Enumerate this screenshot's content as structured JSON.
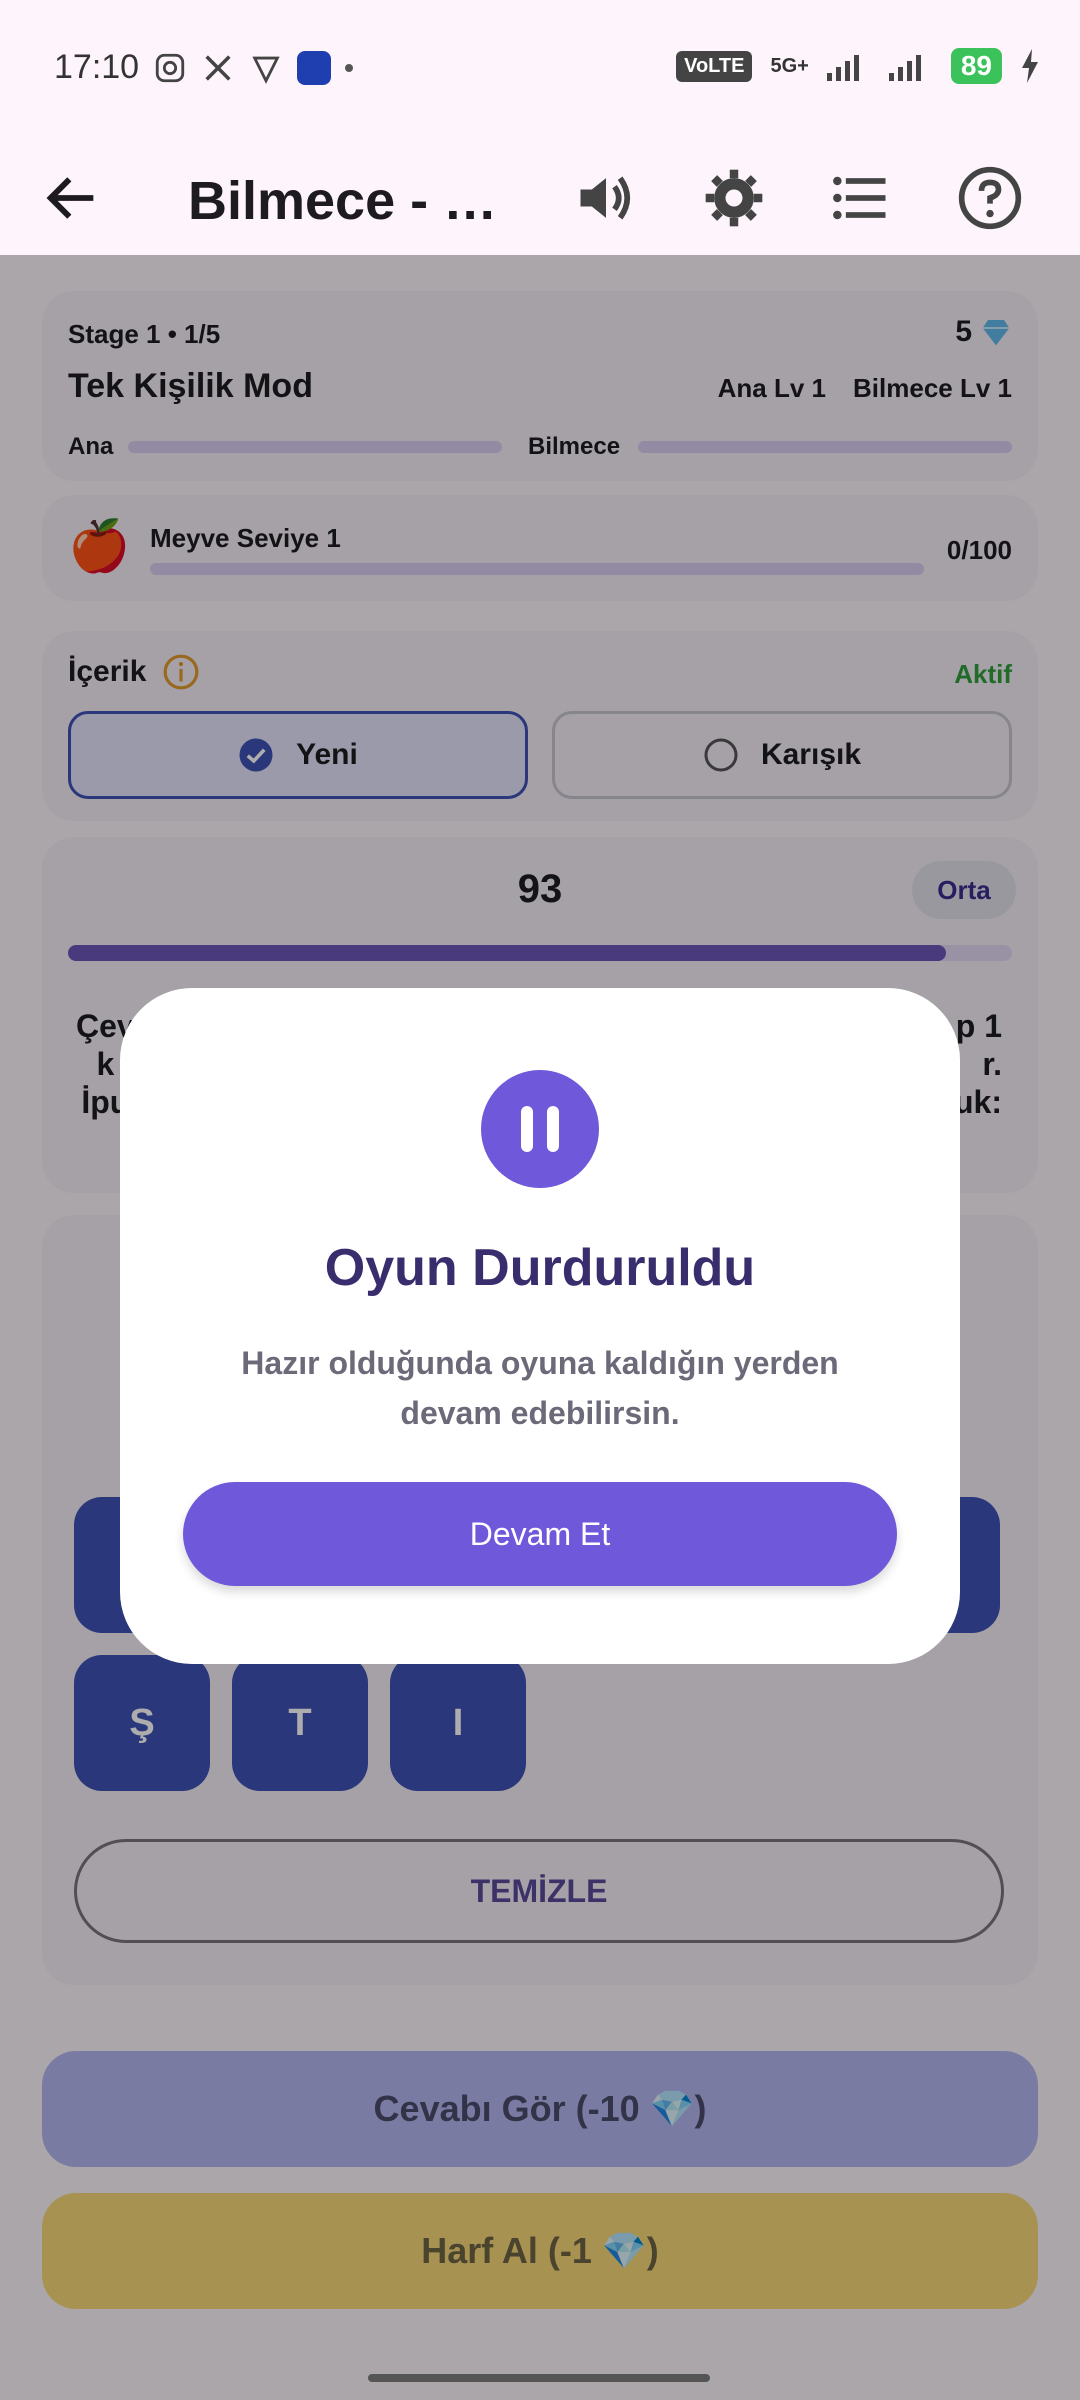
{
  "status_bar": {
    "time": "17:10",
    "volte": "VoLTE",
    "sim_index": "1",
    "network": "5G+",
    "battery": "89"
  },
  "app_bar": {
    "title": "Bilmece - T…",
    "back_icon": "arrow-back-icon",
    "actions": [
      "volume-icon",
      "settings-gear-icon",
      "list-icon",
      "help-icon"
    ]
  },
  "stage_card": {
    "stage": "Stage 1 • 1/5",
    "gems": "5",
    "mode": "Tek Kişilik Mod",
    "ana_level": "Ana Lv 1",
    "bilmece_level": "Bilmece Lv 1",
    "ana_label": "Ana",
    "bilmece_label": "Bilmece"
  },
  "category_card": {
    "emoji": "🍎",
    "label": "Meyve Seviye 1",
    "progress_text": "0/100",
    "progress_value": 0
  },
  "content_card": {
    "label": "İçerik",
    "status": "Aktif",
    "options": [
      {
        "label": "Yeni",
        "selected": true
      },
      {
        "label": "Karışık",
        "selected": false
      }
    ]
  },
  "riddle_card": {
    "timer": "93",
    "difficulty": "Orta",
    "timer_progress": 0.93,
    "text_left": [
      "Çev",
      "k",
      "İpu"
    ],
    "text_right": [
      "p 1",
      "r.",
      "uk:"
    ]
  },
  "letters": {
    "row2": [
      "Ş",
      "T",
      "I"
    ],
    "clear_label": "TEMİZLE"
  },
  "buttons": {
    "see_answer": "Cevabı Gör (-10 💎)",
    "get_letter": "Harf Al (-1 💎)"
  },
  "dialog": {
    "title": "Oyun Durduruldu",
    "message": "Hazır olduğunda oyuna kaldığın yerden devam edebilirsin.",
    "continue_label": "Devam Et"
  },
  "colors": {
    "accent": "#6f58d9",
    "key_blue": "#3f51b5",
    "active_green": "#2e9e3a",
    "amber": "#f6d77a"
  }
}
